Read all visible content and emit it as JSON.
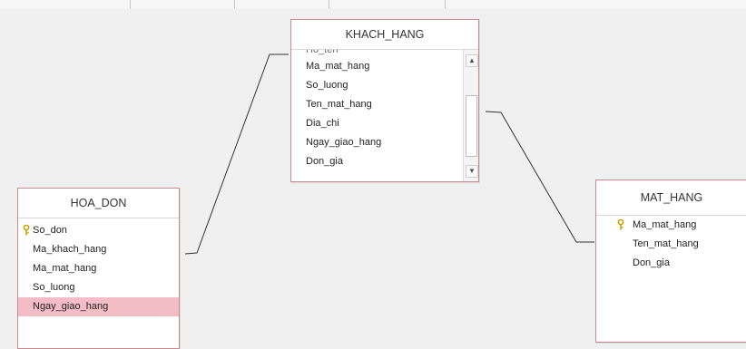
{
  "tables": {
    "khach_hang": {
      "title": "KHACH_HANG",
      "partial_field": "Ho_ten",
      "fields": [
        "Ma_mat_hang",
        "So_luong",
        "Ten_mat_hang",
        "Dia_chi",
        "Ngay_giao_hang",
        "Don_gia"
      ]
    },
    "hoa_don": {
      "title": "HOA_DON",
      "key_field": "So_don",
      "fields": [
        "Ma_khach_hang",
        "Ma_mat_hang",
        "So_luong",
        "Ngay_giao_hang"
      ]
    },
    "mat_hang": {
      "title": "MAT_HANG",
      "key_field": "Ma_mat_hang",
      "fields": [
        "Ten_mat_hang",
        "Don_gia"
      ]
    }
  },
  "colors": {
    "table_border": "#c98a90",
    "selected_row": "#f4bcc4",
    "key_icon": "#c9a100"
  },
  "icons": {
    "primary_key": "key-icon",
    "scroll_up": "scroll-up-arrow",
    "scroll_down": "scroll-down-arrow"
  }
}
